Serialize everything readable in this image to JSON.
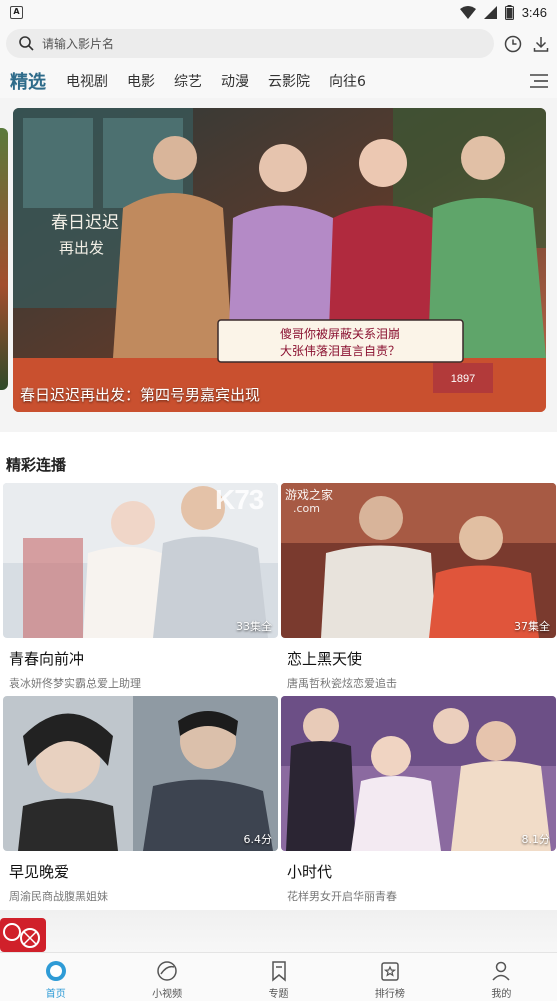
{
  "status_bar": {
    "time": "3:46",
    "app_badge": "A"
  },
  "search": {
    "placeholder": "请输入影片名"
  },
  "header": {
    "history_icon": "clock-icon",
    "download_icon": "download-icon",
    "menu_icon": "menu-icon"
  },
  "tabs": [
    {
      "label": "精选",
      "active": true
    },
    {
      "label": "电视剧"
    },
    {
      "label": "电影"
    },
    {
      "label": "综艺"
    },
    {
      "label": "动漫"
    },
    {
      "label": "云影院"
    },
    {
      "label": "向往6"
    }
  ],
  "banner": {
    "caption": "春日迟迟再出发：第四号男嘉宾出现",
    "overlay_text_1": "春日迟迟",
    "overlay_text_2": "再出发",
    "sign_text": "傻哥你被屏蔽关系泪崩 大张伟落泪直言自责？",
    "prop_text": "1897"
  },
  "section": {
    "title": "精彩连播",
    "cards": [
      {
        "title": "青春向前冲",
        "desc": "袁冰妍佟梦实霸总爱上助理",
        "badge": "33集全"
      },
      {
        "title": "恋上黑天使",
        "desc": "唐禹哲秋瓷炫恋爱追击",
        "badge": "37集全"
      },
      {
        "title": "早见晚爱",
        "desc": "周渝民商战腹黑姐妹",
        "badge": "6.4分"
      },
      {
        "title": "小时代",
        "desc": "花样男女开启华丽青春",
        "badge": "8.1分"
      }
    ]
  },
  "watermark": {
    "logo": "K73",
    "name": "游戏之家",
    "domain": ".com"
  },
  "bottom_nav": [
    {
      "label": "首页",
      "icon": "home-icon",
      "active": true
    },
    {
      "label": "小视频",
      "icon": "short-video-icon"
    },
    {
      "label": "专题",
      "icon": "bookmark-icon"
    },
    {
      "label": "排行榜",
      "icon": "ranking-icon"
    },
    {
      "label": "我的",
      "icon": "profile-icon"
    }
  ],
  "colors": {
    "accent": "#2e6b8a",
    "nav_active": "#2e9bd6"
  }
}
